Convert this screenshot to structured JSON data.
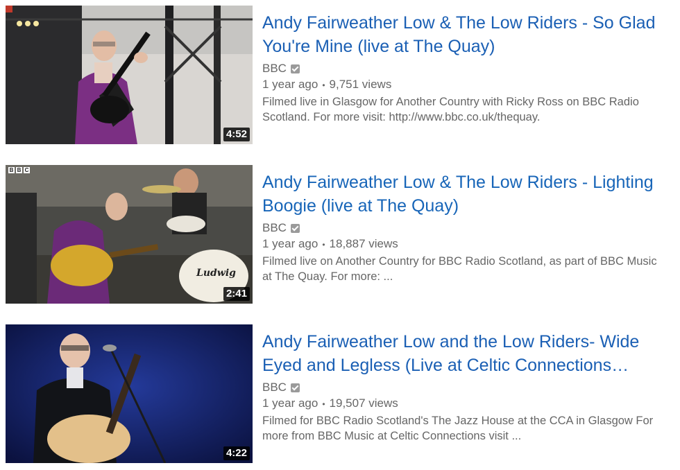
{
  "results": [
    {
      "title": "Andy Fairweather Low & The Low Riders - So Glad You're Mine (live at The Quay)",
      "channel": "BBC",
      "age": "1 year ago",
      "views": "9,751 views",
      "description": "Filmed live in Glasgow for Another Country with Ricky Ross on BBC Radio Scotland. For more visit: http://www.bbc.co.uk/thequay.",
      "duration": "4:52"
    },
    {
      "title": "Andy Fairweather Low & The Low Riders - Lighting Boogie (live at The Quay)",
      "channel": "BBC",
      "age": "1 year ago",
      "views": "18,887 views",
      "description": "Filmed live on Another Country for BBC Radio Scotland, as part of BBC Music at The Quay. For more: ...",
      "duration": "2:41",
      "watermark": [
        "B",
        "B",
        "C"
      ],
      "drum_text": "Ludwig"
    },
    {
      "title": "Andy Fairweather Low and the Low Riders- Wide Eyed and Legless (Live at Celtic Connections…",
      "channel": "BBC",
      "age": "1 year ago",
      "views": "19,507 views",
      "description": "Filmed for BBC Radio Scotland's The Jazz House at the CCA in Glasgow For more from BBC Music at Celtic Connections visit ...",
      "duration": "4:22"
    }
  ],
  "icons": {
    "verified": "verified-badge-icon"
  },
  "colors": {
    "title_link": "#1a5fb4",
    "meta_text": "#666666",
    "duration_bg": "#000000"
  }
}
